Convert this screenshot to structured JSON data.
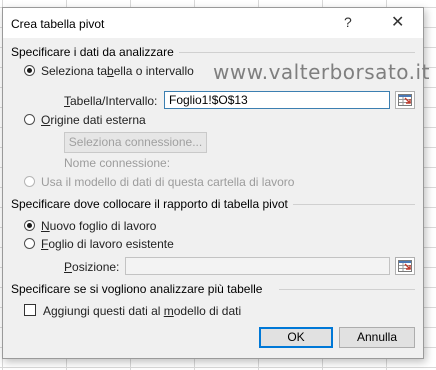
{
  "dialog": {
    "title": "Crea tabella pivot",
    "help_glyph": "?",
    "close_glyph": "✕"
  },
  "section_source": {
    "label": "Specificare i dati da analizzare",
    "option_table": {
      "before": "Seleziona ta",
      "underline": "b",
      "after": "ella o intervallo",
      "checked": true
    },
    "range_label": {
      "underline": "T",
      "after": "abella/Intervallo:"
    },
    "range_value": "Foglio1!$O$13",
    "option_external": {
      "underline": "O",
      "after": "rigine dati esterna",
      "checked": false
    },
    "choose_connection_button": "Seleziona connessione...",
    "connection_name_label": "Nome connessione:",
    "option_data_model": {
      "label": "Usa il modello di dati di questa cartella di lavoro",
      "checked": false
    }
  },
  "watermark": "www.valterborsato.it",
  "section_location": {
    "label": "Specificare dove collocare il rapporto di tabella pivot",
    "option_new_sheet": {
      "underline": "N",
      "after": "uovo foglio di lavoro",
      "checked": true
    },
    "option_existing_sheet": {
      "underline": "F",
      "after": "oglio di lavoro esistente",
      "checked": false
    },
    "position_label": {
      "underline": "P",
      "after": "osizione:"
    },
    "position_value": ""
  },
  "section_multiple": {
    "label": "Specificare se si vogliono analizzare più tabelle",
    "add_to_model": {
      "before": "Aggiungi questi dati al ",
      "underline": "m",
      "after": "odello di dati",
      "checked": false
    }
  },
  "buttons": {
    "ok": "OK",
    "cancel": "Annulla"
  }
}
